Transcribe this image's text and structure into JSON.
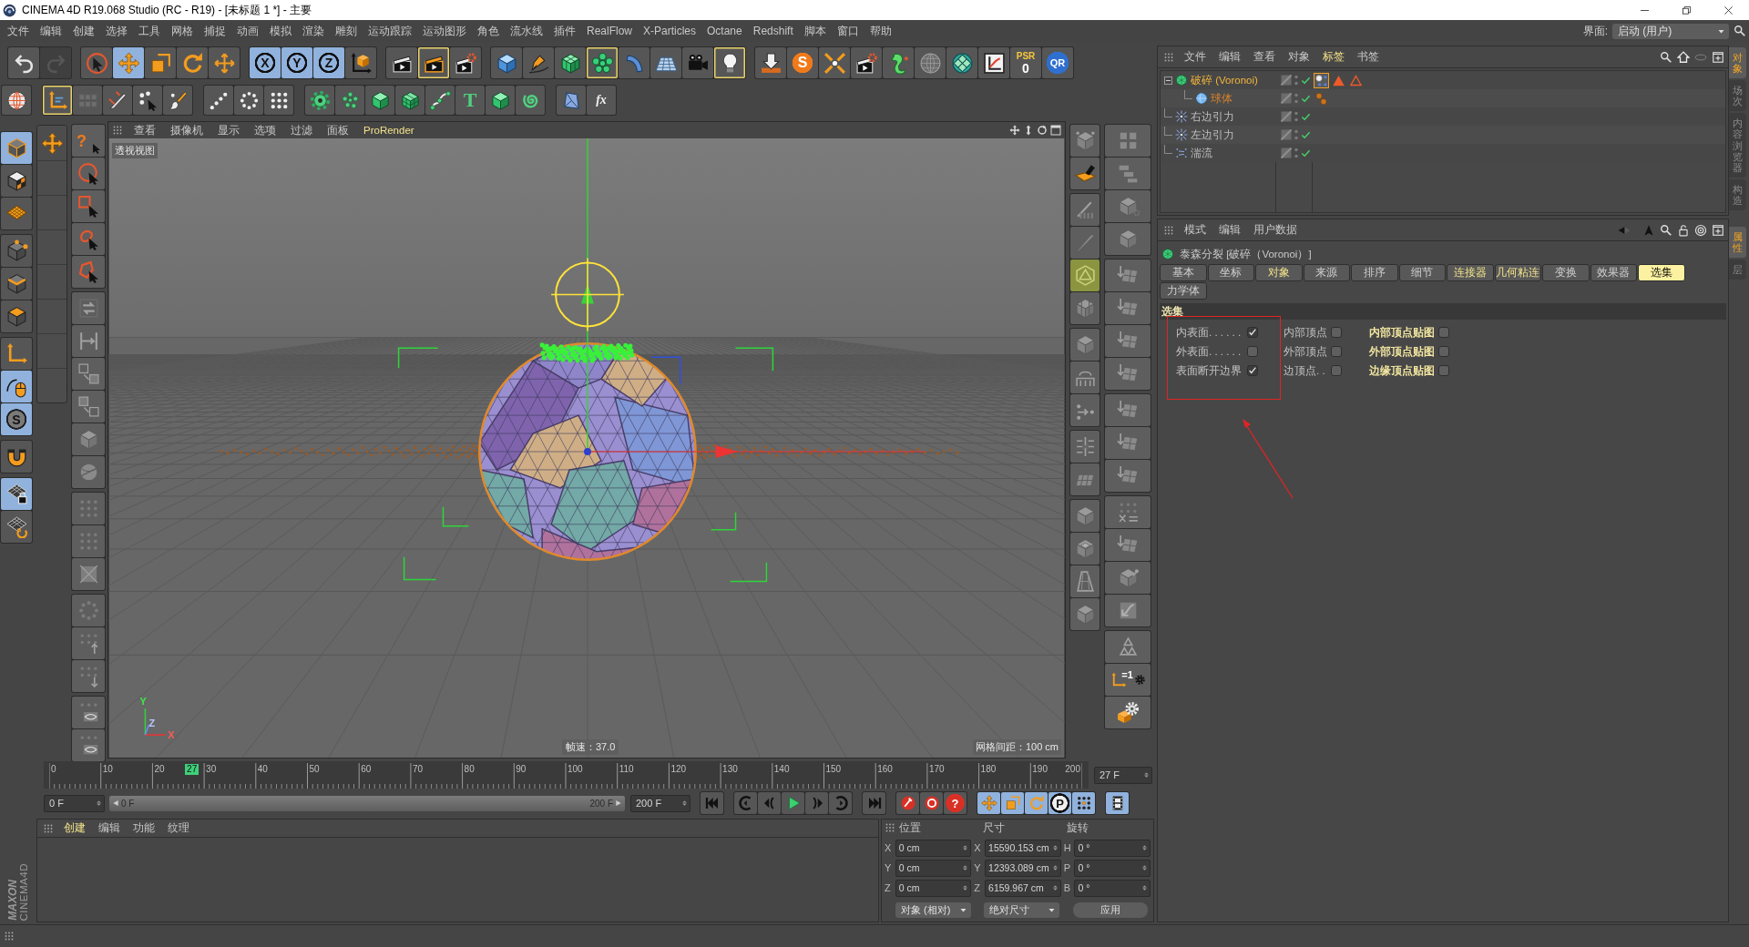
{
  "window": {
    "title": "CINEMA 4D R19.068 Studio (RC - R19) - [未标题 1 *] - 主要"
  },
  "menu_bar": [
    "文件",
    "编辑",
    "创建",
    "选择",
    "工具",
    "网格",
    "捕捉",
    "动画",
    "模拟",
    "渲染",
    "雕刻",
    "运动跟踪",
    "运动图形",
    "角色",
    "流水线",
    "插件",
    "RealFlow",
    "X-Particles",
    "Octane",
    "Redshift",
    "脚本",
    "窗口",
    "帮助"
  ],
  "layout_selector": {
    "label": "界面:",
    "value": "启动 (用户)"
  },
  "main_toolbar": [
    {
      "buttons": [
        {
          "selected": false,
          "disabled": false
        },
        {
          "selected": false,
          "disabled": true
        }
      ]
    },
    {
      "buttons": [
        {
          "on": false
        },
        {
          "on": true
        },
        {
          "on": false
        },
        {
          "on": false
        },
        {
          "on": false
        }
      ]
    },
    {
      "buttons": [
        {
          "label": "X",
          "on": true
        },
        {
          "label": "Y",
          "on": true
        },
        {
          "label": "Z",
          "on": true
        },
        {
          "on": false
        }
      ]
    },
    {
      "buttons": [
        {
          "selected": false
        },
        {
          "selected": true
        },
        {
          "selected": false
        }
      ]
    },
    {
      "buttons": [
        {
          "selected": false
        },
        {
          "selected": false
        },
        {
          "selected": false
        },
        {
          "selected": true
        },
        {
          "selected": false
        },
        {
          "selected": false
        },
        {
          "selected": false
        },
        {
          "selected": true
        }
      ]
    },
    {
      "buttons": [
        {
          "selected": false
        },
        {
          "label": "S",
          "selected": false
        },
        {
          "selected": false
        },
        {
          "selected": false
        },
        {
          "selected": false
        },
        {
          "selected": false
        },
        {
          "selected": false
        },
        {
          "selected": false
        },
        {
          "label": "PSR",
          "sublabel": "0",
          "selected": false
        },
        {
          "label": "QR",
          "selected": false
        }
      ]
    }
  ],
  "mode_toolbar": [
    {
      "buttons": [
        {
          "selected": false
        }
      ]
    },
    {
      "buttons": [
        {
          "selected": true
        },
        {
          "selected": false
        },
        {
          "selected": false
        },
        {
          "selected": false
        },
        {
          "selected": false
        }
      ]
    },
    {
      "buttons": [
        {
          "selected": false
        },
        {
          "selected": false
        },
        {
          "selected": false
        }
      ]
    },
    {
      "buttons": [
        {
          "selected": false
        },
        {
          "selected": false
        },
        {
          "selected": false
        },
        {
          "selected": false
        },
        {
          "selected": false
        },
        {
          "label": "T",
          "selected": false
        },
        {
          "selected": false
        },
        {
          "selected": false
        }
      ]
    },
    {
      "buttons": [
        {
          "selected": false
        },
        {
          "label": "fx",
          "selected": false
        }
      ]
    }
  ],
  "left_toolbar": [
    {
      "buttons": [
        {
          "on": true
        },
        {
          "on": false
        },
        {
          "on": false
        }
      ]
    },
    {
      "buttons": [
        {
          "on": false
        },
        {
          "on": false
        },
        {
          "on": false
        }
      ]
    },
    {
      "buttons": [
        {
          "on": false
        },
        {
          "on": true
        },
        {
          "label": "S",
          "on": true
        }
      ]
    },
    {
      "buttons": [
        {
          "on": false
        }
      ]
    },
    {
      "buttons": [
        {
          "on": true
        },
        {
          "on": false
        }
      ]
    }
  ],
  "tool_palette": [
    {
      "buttons": [
        {
          "selected": false
        }
      ]
    }
  ],
  "selection_toolbar": [
    {
      "buttons": [
        {
          "label": "?",
          "selected": false
        },
        {
          "selected": false
        },
        {
          "selected": false
        },
        {
          "selected": false
        },
        {
          "selected": false
        }
      ]
    },
    {
      "buttons": [
        {
          "selected": false
        },
        {
          "selected": false
        },
        {
          "selected": false
        },
        {
          "selected": false
        },
        {
          "selected": false
        },
        {
          "selected": false
        }
      ]
    },
    {
      "buttons": [
        {
          "selected": false
        },
        {
          "selected": false
        },
        {
          "selected": false
        }
      ]
    },
    {
      "buttons": [
        {
          "selected": false
        },
        {
          "selected": false
        },
        {
          "selected": false
        }
      ]
    },
    {
      "buttons": [
        {
          "selected": false
        },
        {
          "selected": false
        }
      ]
    }
  ],
  "viewport": {
    "menu": [
      {
        "label": "查看",
        "highlighted": false
      },
      {
        "label": "摄像机",
        "highlighted": false
      },
      {
        "label": "显示",
        "highlighted": false
      },
      {
        "label": "选项",
        "highlighted": false
      },
      {
        "label": "过滤",
        "highlighted": false
      },
      {
        "label": "面板",
        "highlighted": false
      },
      {
        "label": "ProRender",
        "highlighted": true
      }
    ],
    "view_name": "透视视图",
    "axis_labels": [
      "Y",
      "Z",
      "X"
    ],
    "frame_rate": "帧速：37.0",
    "grid_spacing": "网格间距：100 cm"
  },
  "modeling_tools": {
    "column_1": [
      {
        "buttons": [
          {
            "active": false
          },
          {
            "active": false
          }
        ]
      },
      {
        "buttons": [
          {
            "active": false
          },
          {
            "active": false
          },
          {
            "active": true
          },
          {
            "active": false
          }
        ]
      },
      {
        "buttons": [
          {
            "active": false
          },
          {
            "active": false
          },
          {
            "active": false
          }
        ]
      },
      {
        "buttons": [
          {
            "active": false
          },
          {
            "active": false
          }
        ]
      },
      {
        "buttons": [
          {
            "active": false
          },
          {
            "active": false
          },
          {
            "active": false
          },
          {
            "active": false
          }
        ]
      }
    ],
    "column_2": [
      {
        "buttons": [
          {
            "active": false
          },
          {
            "active": false
          },
          {
            "active": false
          },
          {
            "active": false
          }
        ]
      },
      {
        "buttons": [
          {
            "active": false
          },
          {
            "active": false
          },
          {
            "active": false
          },
          {
            "active": false
          }
        ]
      },
      {
        "buttons": [
          {
            "active": false
          },
          {
            "active": false
          },
          {
            "active": false
          }
        ]
      },
      {
        "buttons": [
          {
            "active": false
          },
          {
            "active": false
          },
          {
            "active": false
          },
          {
            "active": false
          }
        ]
      },
      {
        "buttons": [
          {
            "active": false
          },
          {
            "label": "=1",
            "active": false
          },
          {
            "active": false
          }
        ]
      }
    ]
  },
  "object_manager": {
    "menu": [
      {
        "label": "文件",
        "highlighted": false
      },
      {
        "label": "编辑",
        "highlighted": false
      },
      {
        "label": "查看",
        "highlighted": false
      },
      {
        "label": "对象",
        "highlighted": false
      },
      {
        "label": "标签",
        "highlighted": true
      },
      {
        "label": "书签",
        "highlighted": false
      }
    ],
    "objects": [
      {
        "name": "破碎 (Voronoi)",
        "selected": true,
        "active": true,
        "enabled": true,
        "expanded": true,
        "tags": [
          {
            "selected": true
          },
          {
            "selected": false
          },
          {
            "selected": false
          }
        ],
        "children": [
          {
            "name": "球体",
            "selected": true,
            "active": false,
            "enabled": true,
            "tags": [
              {
                "selected": false
              }
            ]
          }
        ]
      },
      {
        "name": "右边引力",
        "selected": false,
        "active": false,
        "enabled": true
      },
      {
        "name": "左边引力",
        "selected": false,
        "active": false,
        "enabled": true
      },
      {
        "name": "湍流",
        "selected": false,
        "active": false,
        "enabled": true
      }
    ]
  },
  "attributes": {
    "menu": [
      "模式",
      "编辑",
      "用户数据"
    ],
    "title": "泰森分裂 [破碎（Voronoi）]",
    "tabs": [
      {
        "label": "基本",
        "selected": false,
        "highlighted": false
      },
      {
        "label": "坐标",
        "selected": false,
        "highlighted": false
      },
      {
        "label": "对象",
        "selected": false,
        "highlighted": true
      },
      {
        "label": "来源",
        "selected": false,
        "highlighted": false
      },
      {
        "label": "排序",
        "selected": false,
        "highlighted": false
      },
      {
        "label": "细节",
        "selected": false,
        "highlighted": false
      },
      {
        "label": "连接器",
        "selected": false,
        "highlighted": true
      },
      {
        "label": "几何粘连",
        "selected": false,
        "highlighted": true
      },
      {
        "label": "变换",
        "selected": false,
        "highlighted": false
      },
      {
        "label": "效果器",
        "selected": false,
        "highlighted": false
      },
      {
        "label": "选集",
        "selected": true,
        "highlighted": false
      },
      {
        "label": "力学体",
        "selected": false,
        "highlighted": false
      }
    ],
    "section": "选集",
    "options": [
      [
        {
          "label": "内表面. . . . . .",
          "checked": true,
          "highlighted": false
        },
        {
          "label": "外表面. . . . . .",
          "checked": false,
          "highlighted": false
        },
        {
          "label": "表面断开边界",
          "checked": true,
          "highlighted": false
        }
      ],
      [
        {
          "label": "内部顶点",
          "checked": false,
          "highlighted": false
        },
        {
          "label": "外部顶点",
          "checked": false,
          "highlighted": false
        },
        {
          "label": "边顶点. .",
          "checked": false,
          "highlighted": false
        }
      ],
      [
        {
          "label": "内部顶点贴图",
          "checked": false,
          "highlighted": true
        },
        {
          "label": "外部顶点贴图",
          "checked": false,
          "highlighted": true
        },
        {
          "label": "边缘顶点贴图",
          "checked": false,
          "highlighted": true
        }
      ]
    ]
  },
  "side_tabs": {
    "top": [
      {
        "label": "对象",
        "selected": true
      },
      {
        "label": "场次",
        "selected": false
      },
      {
        "label": "内容浏览器",
        "selected": false
      },
      {
        "label": "构造",
        "selected": false
      }
    ],
    "bottom": [
      {
        "label": "属性",
        "selected": true
      },
      {
        "label": "层",
        "selected": false
      }
    ]
  },
  "timeline": {
    "ruler": [
      "0",
      "10",
      "20",
      "30",
      "40",
      "50",
      "60",
      "70",
      "80",
      "90",
      "100",
      "110",
      "120",
      "130",
      "140",
      "150",
      "160",
      "170",
      "180",
      "190",
      "200"
    ],
    "playhead": {
      "label": "27",
      "level": 0.135
    },
    "current_frame": "27 F"
  },
  "playback": {
    "start_frame": "0 F",
    "range": {
      "start": "0 F",
      "end": "200 F",
      "level": 1
    },
    "end_frame": "200 F",
    "groups": [
      {
        "buttons": [
          {
            "selected": false
          }
        ]
      },
      {
        "buttons": [
          {
            "selected": false
          },
          {
            "selected": false
          },
          {
            "selected": false
          },
          {
            "selected": false
          },
          {
            "selected": false
          }
        ]
      },
      {
        "buttons": [
          {
            "selected": false
          }
        ]
      },
      {
        "buttons": [
          {
            "selected": false
          },
          {
            "selected": false
          },
          {
            "label": "?",
            "selected": false
          }
        ]
      },
      {
        "buttons": [
          {
            "on": true
          },
          {
            "on": true
          },
          {
            "on": true
          },
          {
            "label": "P",
            "on": true
          },
          {
            "on": true
          }
        ]
      },
      {
        "buttons": [
          {
            "on": true
          }
        ]
      }
    ]
  },
  "material_manager": {
    "menu": [
      {
        "label": "创建",
        "highlighted": true
      },
      {
        "label": "编辑",
        "highlighted": false
      },
      {
        "label": "功能",
        "highlighted": false
      },
      {
        "label": "纹理",
        "highlighted": false
      }
    ]
  },
  "coordinates": {
    "headers": [
      "位置",
      "尺寸",
      "旋转"
    ],
    "rows": [
      [
        {
          "axis": "X",
          "value": "0 cm"
        },
        {
          "axis": "X",
          "value": "15590.153 cm"
        },
        {
          "axis": "H",
          "value": "0 °"
        }
      ],
      [
        {
          "axis": "Y",
          "value": "0 cm"
        },
        {
          "axis": "Y",
          "value": "12393.089 cm"
        },
        {
          "axis": "P",
          "value": "0 °"
        }
      ],
      [
        {
          "axis": "Z",
          "value": "0 cm"
        },
        {
          "axis": "Z",
          "value": "6159.967 cm"
        },
        {
          "axis": "B",
          "value": "0 °"
        }
      ]
    ],
    "dropdowns": [
      "对象 (相对)",
      "绝对尺寸"
    ],
    "apply": "应用"
  },
  "logo": {
    "brand": "MAXON",
    "product": "CINEMA4D"
  },
  "annotations": [
    {
      "kind": "box"
    },
    {
      "kind": "arrow"
    }
  ]
}
